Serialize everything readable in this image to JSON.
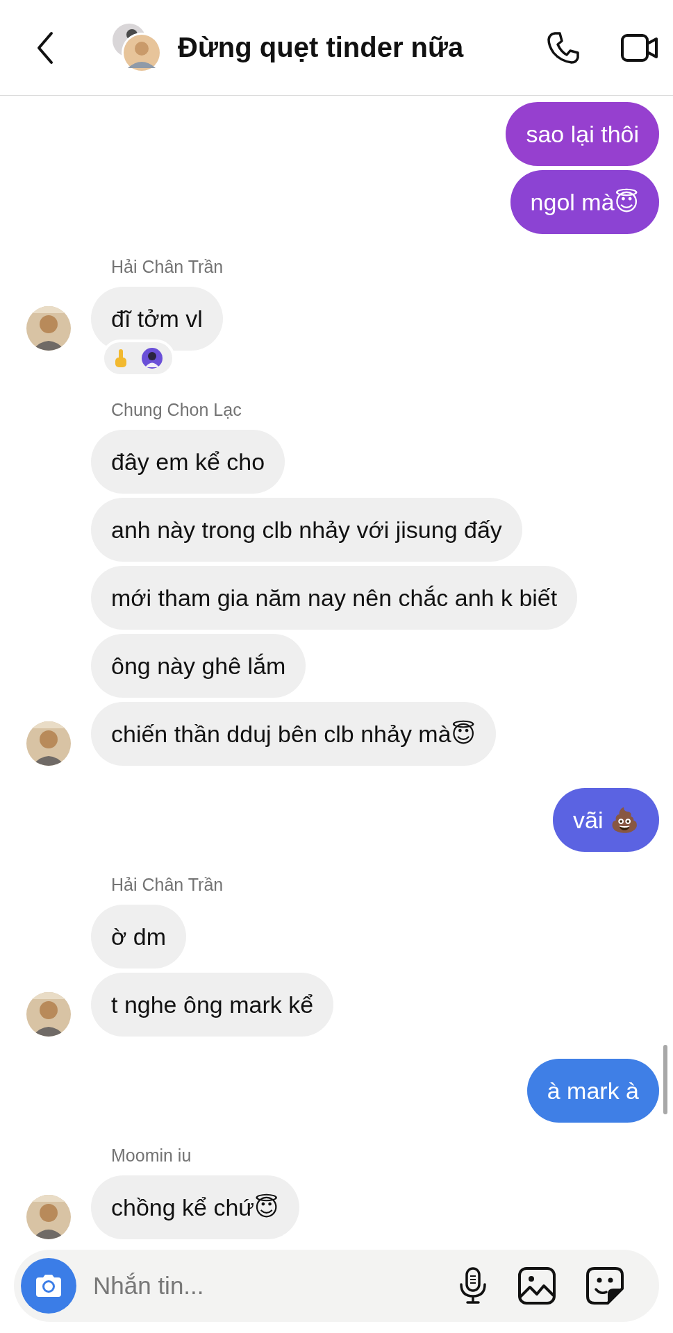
{
  "header": {
    "title": "Đừng quẹt tinder nữa"
  },
  "groups": [
    {
      "kind": "sent",
      "bubbles": [
        {
          "text": "sao lại thôi",
          "color": "#9640cf"
        },
        {
          "text": "ngol mà😇",
          "color": "#8c43d3"
        }
      ]
    },
    {
      "kind": "received",
      "sender": "Hải Chân Trần",
      "bubbles": [
        {
          "text": "đĩ tởm vl",
          "reacted": true
        }
      ]
    },
    {
      "kind": "received",
      "sender": "Chung Chon Lạc",
      "bubbles": [
        {
          "text": "đây em kể cho",
          "reacted": false
        },
        {
          "text": "anh này trong clb nhảy với jisung đấy",
          "reacted": false
        },
        {
          "text": "mới tham gia năm nay nên chắc anh k biết",
          "reacted": false
        },
        {
          "text": "ông này ghê lắm",
          "reacted": false
        },
        {
          "text": "chiến thần dduj bên clb nhảy mà😇",
          "reacted": false
        }
      ]
    },
    {
      "kind": "sent",
      "bubbles": [
        {
          "text": "vãi 💩",
          "color": "#5b63e2"
        }
      ]
    },
    {
      "kind": "received",
      "sender": "Hải Chân Trần",
      "bubbles": [
        {
          "text": "ờ dm",
          "reacted": false
        },
        {
          "text": "t nghe ông mark kể",
          "reacted": false
        }
      ]
    },
    {
      "kind": "sent",
      "bubbles": [
        {
          "text": "à mark à",
          "color": "#3f7fe6"
        }
      ]
    },
    {
      "kind": "received",
      "sender": "Moomin iu",
      "bubbles": [
        {
          "text": "chồng kể chứ😇",
          "reacted": false
        }
      ]
    }
  ],
  "composer": {
    "placeholder": "Nhắn tin..."
  }
}
